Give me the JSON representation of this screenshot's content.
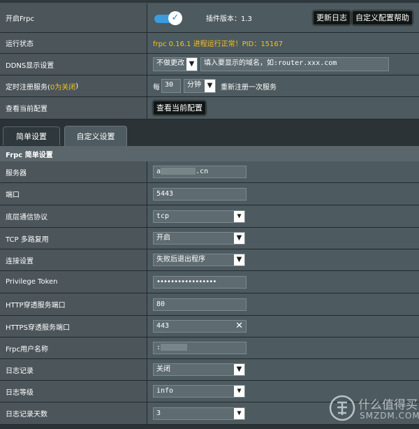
{
  "settings": {
    "enable_label": "开启Frpc",
    "version_label": "插件版本：1.3",
    "changelog_button": "更新日志",
    "custom_help_button": "自定义配置帮助",
    "status_label": "运行状态",
    "status_text": "frpc 0.16.1 进程运行正常！PID：15167",
    "ddns_label": "DDNS显示设置",
    "ddns_select": "不做更改",
    "ddns_placeholder": "填入要显示的域名，如:router.xxx.com",
    "timer_label_prefix": "定时注册服务(",
    "timer_label_zero": "0为关闭",
    "timer_label_suffix": ")",
    "timer_every": "每",
    "timer_value": "30",
    "timer_unit": "分钟",
    "timer_suffix": "重新注册一次服务",
    "view_config_label": "查看当前配置",
    "view_config_button": "查看当前配置"
  },
  "tabs": [
    {
      "label": "简单设置",
      "active": true
    },
    {
      "label": "自定义设置",
      "active": false
    }
  ],
  "section_title": "Frpc 简单设置",
  "form": {
    "server_label": "服务器",
    "server_value_prefix": "a",
    "server_value_suffix": ".cn",
    "port_label": "端口",
    "port_value": "5443",
    "protocol_label": "底层通信协议",
    "protocol_value": "tcp",
    "tcp_mux_label": "TCP 多路复用",
    "tcp_mux_value": "开启",
    "connect_label": "连接设置",
    "connect_value": "失败后退出程序",
    "token_label": "Privilege Token",
    "token_value": "•••••••••••••••••",
    "http_port_label": "HTTP穿透服务端口",
    "http_port_value": "80",
    "https_port_label": "HTTPS穿透服务端口",
    "https_port_value": "443",
    "user_label": "Frpc用户名称",
    "user_value": ":",
    "log_label": "日志记录",
    "log_value": "关闭",
    "log_level_label": "日志等级",
    "log_level_value": "info",
    "log_days_label": "日志记录天数",
    "log_days_value": "3"
  },
  "watermark": {
    "text": "什么值得买",
    "sub": "SMZDM.COM",
    "icon": "smzdm-logo-icon"
  },
  "colors": {
    "accent_blue": "#3b9bdc",
    "status_yellow": "#f7c21c",
    "zero_off_yellow": "#f7c21c"
  }
}
